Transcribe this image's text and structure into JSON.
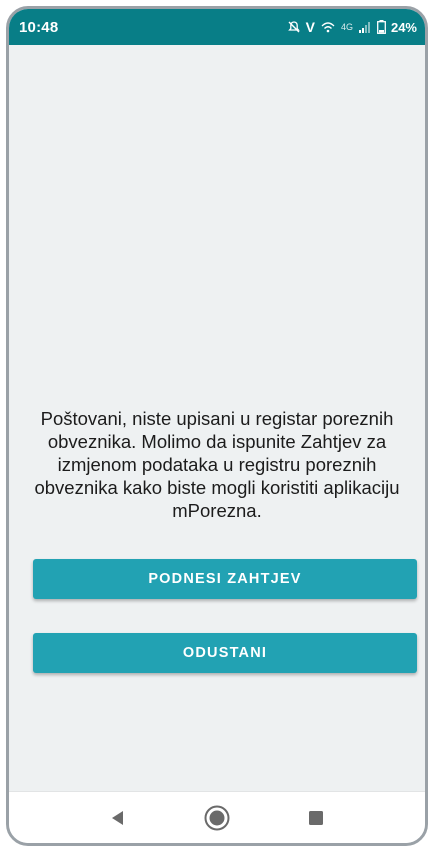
{
  "status_bar": {
    "time": "10:48",
    "network_type": "4G",
    "volte_label": "V",
    "battery": "24%",
    "icons": [
      "mute-icon",
      "volte-icon",
      "wifi-calling-icon",
      "signal-icon",
      "battery-icon"
    ]
  },
  "main": {
    "message": "Poštovani, niste upisani u registar poreznih obveznika. Molimo da ispunite Zahtjev za izmjenom podataka u registru poreznih obveznika kako biste mogli koristiti aplikaciju mPorezna.",
    "submit_button": "PODNESI ZAHTJEV",
    "cancel_button": "ODUSTANI"
  },
  "nav_bar": {
    "icons": [
      "back-icon",
      "home-icon",
      "recents-icon"
    ]
  },
  "colors": {
    "status_bar": "#087e87",
    "button": "#22a2b3",
    "background": "#eef1f2",
    "text": "#1c1c1c"
  }
}
